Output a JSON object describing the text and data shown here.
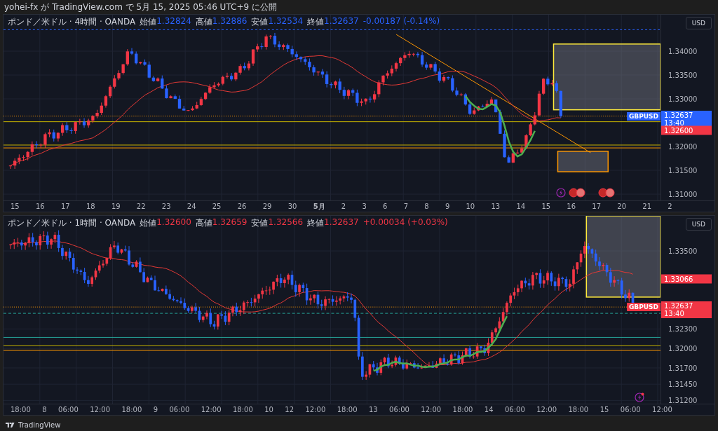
{
  "header": {
    "text": "yohei-fx が TradingView.com で 5月 15, 2025 05:46 UTC+9 に公開"
  },
  "panels": [
    {
      "symbol": "ポンド／米ドル · 4時間 · OANDA",
      "color": "#2962ff",
      "ohlc": [
        {
          "label": "始値",
          "value": "1.32824"
        },
        {
          "label": "高値",
          "value": "1.32886"
        },
        {
          "label": "安値",
          "value": "1.32534"
        },
        {
          "label": "終値",
          "value": "1.32637"
        }
      ],
      "change": "-0.00187 (-0.14%)",
      "currency": "USD",
      "price_ticks": [
        "1.34000",
        "1.33500",
        "1.33000",
        "1.32000",
        "1.31500",
        "1.31000"
      ],
      "price_tags": [
        {
          "kind": "symbol",
          "label": "GBPUSD",
          "price": "1.32637",
          "countdown": "13:40",
          "color": "#2962ff"
        },
        {
          "kind": "level",
          "price": "1.32600",
          "color": "#f23645"
        }
      ],
      "time_labels": [
        {
          "text": "15",
          "kind": "day"
        },
        {
          "text": "16",
          "kind": "day"
        },
        {
          "text": "17",
          "kind": "day"
        },
        {
          "text": "18",
          "kind": "day"
        },
        {
          "text": "19",
          "kind": "day"
        },
        {
          "text": "22",
          "kind": "day"
        },
        {
          "text": "23",
          "kind": "day"
        },
        {
          "text": "24",
          "kind": "day"
        },
        {
          "text": "25",
          "kind": "day"
        },
        {
          "text": "26",
          "kind": "day"
        },
        {
          "text": "29",
          "kind": "day"
        },
        {
          "text": "30",
          "kind": "day"
        },
        {
          "text": "5月",
          "kind": "month"
        },
        {
          "text": "2",
          "kind": "day"
        },
        {
          "text": "3",
          "kind": "day"
        },
        {
          "text": "6",
          "kind": "day"
        },
        {
          "text": "7",
          "kind": "day"
        },
        {
          "text": "8",
          "kind": "day"
        },
        {
          "text": "9",
          "kind": "day"
        },
        {
          "text": "10",
          "kind": "day"
        },
        {
          "text": "13",
          "kind": "day"
        },
        {
          "text": "14",
          "kind": "day"
        },
        {
          "text": "15",
          "kind": "day"
        },
        {
          "text": "16",
          "kind": "day"
        },
        {
          "text": "17",
          "kind": "day"
        },
        {
          "text": "20",
          "kind": "day"
        },
        {
          "text": "21",
          "kind": "day"
        },
        {
          "text": "2",
          "kind": "day"
        }
      ]
    },
    {
      "symbol": "ポンド／米ドル · 1時間 · OANDA",
      "color": "#f23645",
      "ohlc": [
        {
          "label": "始値",
          "value": "1.32600"
        },
        {
          "label": "高値",
          "value": "1.32659"
        },
        {
          "label": "安値",
          "value": "1.32566"
        },
        {
          "label": "終値",
          "value": "1.32637"
        }
      ],
      "change": "+0.00034 (+0.03%)",
      "currency": "USD",
      "price_ticks": [
        "1.33500",
        "1.32300",
        "1.32000",
        "1.31700",
        "1.31450",
        "1.31200"
      ],
      "price_tags": [
        {
          "kind": "level",
          "price": "1.33066",
          "color": "#f23645"
        },
        {
          "kind": "symbol",
          "label": "GBPUSD",
          "price": "1.32637",
          "countdown": "13:40",
          "color": "#f23645"
        }
      ],
      "time_labels": [
        {
          "text": "18:00",
          "kind": "time"
        },
        {
          "text": "8",
          "kind": "day"
        },
        {
          "text": "06:00",
          "kind": "time"
        },
        {
          "text": "12:00",
          "kind": "time"
        },
        {
          "text": "18:00",
          "kind": "time"
        },
        {
          "text": "9",
          "kind": "day"
        },
        {
          "text": "06:00",
          "kind": "time"
        },
        {
          "text": "12:00",
          "kind": "time"
        },
        {
          "text": "18:00",
          "kind": "time"
        },
        {
          "text": "10",
          "kind": "day"
        },
        {
          "text": "12",
          "kind": "day"
        },
        {
          "text": "12:00",
          "kind": "time"
        },
        {
          "text": "18:00",
          "kind": "time"
        },
        {
          "text": "13",
          "kind": "day"
        },
        {
          "text": "06:00",
          "kind": "time"
        },
        {
          "text": "12:00",
          "kind": "time"
        },
        {
          "text": "18:00",
          "kind": "time"
        },
        {
          "text": "14",
          "kind": "day"
        },
        {
          "text": "06:00",
          "kind": "time"
        },
        {
          "text": "12:00",
          "kind": "time"
        },
        {
          "text": "18:00",
          "kind": "time"
        },
        {
          "text": "15",
          "kind": "day"
        },
        {
          "text": "06:00",
          "kind": "time"
        },
        {
          "text": "12:00",
          "kind": "time"
        }
      ]
    }
  ],
  "footer": {
    "brand": "TradingView"
  }
}
